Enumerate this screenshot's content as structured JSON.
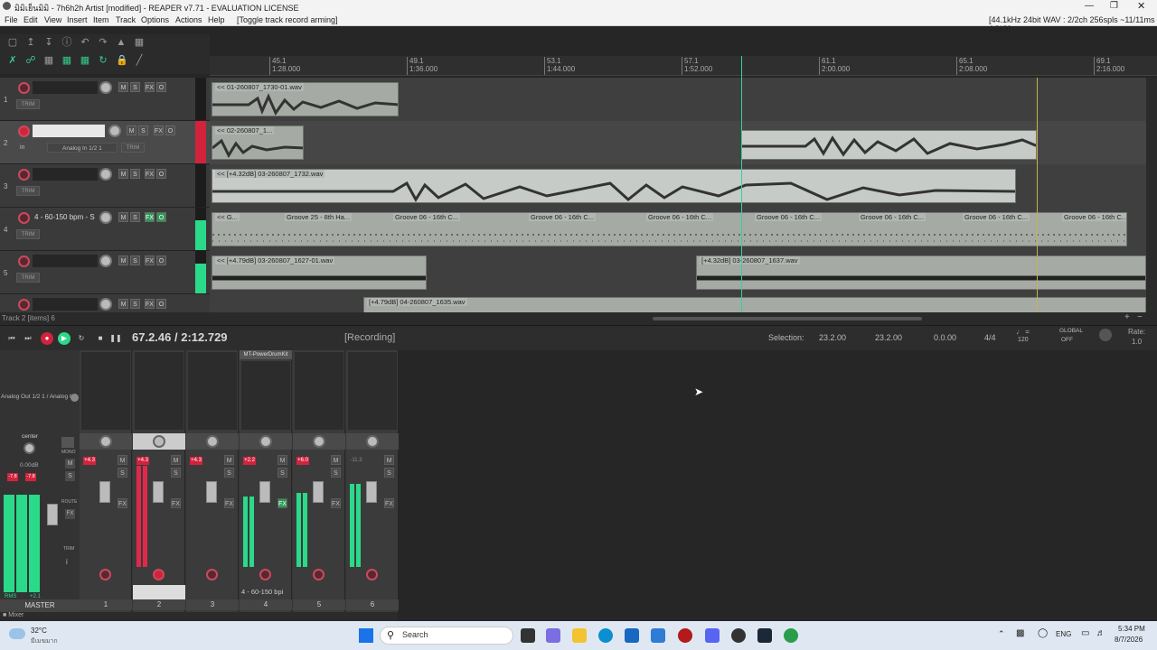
{
  "window": {
    "title": "มิมิเย็นมิมิ - 7h6h2h Artist [modified] - REAPER v7.71 - EVALUATION LICENSE",
    "audio_info": "[44.1kHz 24bit WAV : 2/2ch 256spls ~11/11ms ASIO]"
  },
  "menu": [
    "File",
    "Edit",
    "View",
    "Insert",
    "Item",
    "Track",
    "Options",
    "Actions",
    "Help",
    "[Toggle track record arming]"
  ],
  "ruler": {
    "ticks": [
      {
        "bar": "45.1",
        "time": "1:28.000"
      },
      {
        "bar": "49.1",
        "time": "1:36.000"
      },
      {
        "bar": "53.1",
        "time": "1:44.000"
      },
      {
        "bar": "57.1",
        "time": "1:52.000"
      },
      {
        "bar": "61.1",
        "time": "2:00.000"
      },
      {
        "bar": "65.1",
        "time": "2:08.000"
      },
      {
        "bar": "69.1",
        "time": "2:16.000"
      }
    ]
  },
  "tracks": [
    {
      "num": "1",
      "name": "",
      "armed": false,
      "selected": false
    },
    {
      "num": "2",
      "name": "",
      "armed": true,
      "selected": true,
      "input": "Analog In 1/2 1",
      "in_label": "in"
    },
    {
      "num": "3",
      "name": "",
      "armed": false,
      "selected": false
    },
    {
      "num": "4",
      "name": "4 - 60-150 bpm - S",
      "armed": false,
      "selected": false
    },
    {
      "num": "5",
      "name": "",
      "armed": false,
      "selected": false
    },
    {
      "num": "6",
      "name": "",
      "armed": false,
      "selected": false
    }
  ],
  "track_buttons": {
    "mute": "M",
    "solo": "S",
    "fx": "FX",
    "io": "O",
    "trim": "TRIM"
  },
  "items": {
    "t1a": "<< 01-260807_1730-01.wav",
    "t2a": "<< 02-260807_1...",
    "t3a": "<< [+4.32dB] 03-260807_1732.wav",
    "t4a": "<< G...",
    "t4b": "Groove 25 - 8th Ha...",
    "t4c": "Groove 06 - 16th C...",
    "t5a": "<< [+4.79dB] 03-260807_1627-01.wav",
    "t5b": "[+4.32dB] 03-260807_1637.wav",
    "t6a": "[+4.79dB] 04-260807_1635.wav",
    "item_icons": "M FX"
  },
  "status": {
    "left": "Track 2 [items] 6"
  },
  "transport": {
    "time": "67.2.46 / 2:12.729",
    "state": "[Recording]",
    "selection_label": "Selection:",
    "sel_start": "23.2.00",
    "sel_end": "23.2.00",
    "sel_len": "0.0.00",
    "timesig": "4/4",
    "bpm": "120",
    "global": "GLOBAL",
    "global_off": "OFF",
    "rate_label": "Rate:",
    "rate": "1.0"
  },
  "mixer": {
    "route_label": "Analog Out 1/2 1 / Analog C",
    "master_pan": "center",
    "master_vol": "0.00dB",
    "master_label": "MASTER",
    "master_meter_l": "-7.8",
    "master_meter_r": "-7.8",
    "master_rms": "RMS",
    "master_rms_val": "+2.1",
    "mono": "MONO",
    "route": "ROUTE",
    "fx": "FX",
    "trim": "TRIM",
    "plugin": "MT-PowerDrumKit",
    "strip4_name": "4 - 60-150 bpi",
    "mixer_tab": "Mixer",
    "strips": [
      {
        "idx": "1",
        "peak": "+4.3",
        "armed": false,
        "meter": 0
      },
      {
        "idx": "2",
        "peak": "+4.3",
        "armed": true,
        "meter": 0.9
      },
      {
        "idx": "3",
        "peak": "+4.3",
        "armed": false,
        "meter": 0
      },
      {
        "idx": "4",
        "peak": "+2.2",
        "armed": false,
        "meter": 0.7
      },
      {
        "idx": "5",
        "peak": "+6.0",
        "armed": false,
        "meter": 0.8
      },
      {
        "idx": "6",
        "peak": "-11.3",
        "armed": false,
        "meter": 0.65
      }
    ]
  },
  "taskbar": {
    "weather_temp": "32°C",
    "weather_desc": "มีเมฆมาก",
    "search": "Search",
    "lang": "ENG",
    "time": "5:34 PM",
    "date": "8/7/2026"
  },
  "colors": {
    "accent_green": "#2bd98a",
    "arm_red": "#d2233d",
    "item_gray": "#a5aaa5"
  }
}
